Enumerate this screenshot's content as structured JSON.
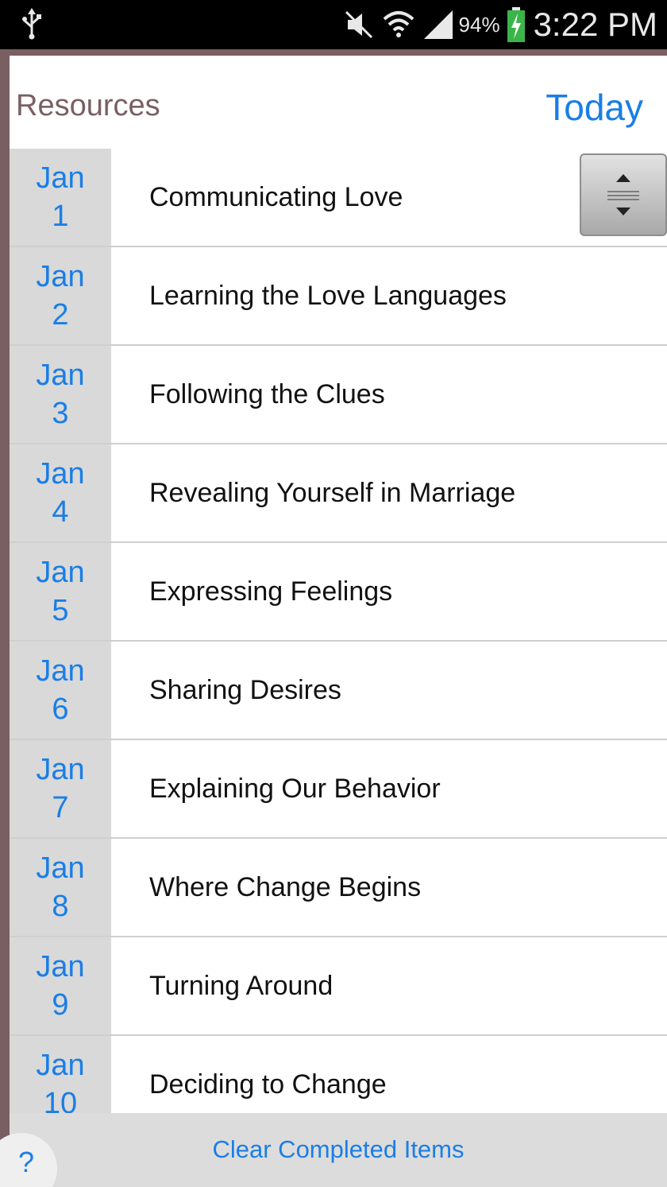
{
  "status_bar": {
    "battery_percent": "94%",
    "time": "3:22 PM",
    "icons": [
      "usb-icon",
      "mute-icon",
      "wifi-icon",
      "signal-icon",
      "battery-charging-icon"
    ]
  },
  "header": {
    "title": "Resources",
    "today_label": "Today"
  },
  "list": {
    "items": [
      {
        "month": "Jan",
        "day": "1",
        "title": "Communicating Love"
      },
      {
        "month": "Jan",
        "day": "2",
        "title": "Learning the Love Languages"
      },
      {
        "month": "Jan",
        "day": "3",
        "title": "Following the Clues"
      },
      {
        "month": "Jan",
        "day": "4",
        "title": "Revealing Yourself in Marriage"
      },
      {
        "month": "Jan",
        "day": "5",
        "title": "Expressing Feelings"
      },
      {
        "month": "Jan",
        "day": "6",
        "title": "Sharing Desires"
      },
      {
        "month": "Jan",
        "day": "7",
        "title": "Explaining Our Behavior"
      },
      {
        "month": "Jan",
        "day": "8",
        "title": "Where Change Begins"
      },
      {
        "month": "Jan",
        "day": "9",
        "title": "Turning Around"
      },
      {
        "month": "Jan",
        "day": "10",
        "title": "Deciding to Change"
      }
    ]
  },
  "footer": {
    "clear_label": "Clear Completed Items",
    "help_label": "?"
  },
  "colors": {
    "accent": "#1a7ee6",
    "title": "#7a5f62",
    "date_bg": "#d9d9d9",
    "frame": "#7a5f62"
  }
}
